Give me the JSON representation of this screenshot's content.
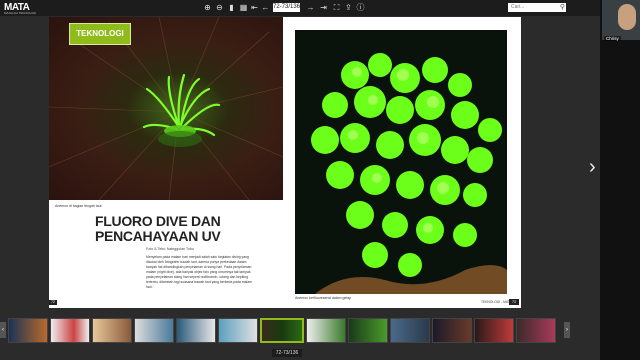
{
  "app": {
    "logo_text": "MATA",
    "logo_subtitle": "MAJALAH TEKNOLOGI"
  },
  "toolbar": {
    "icons": [
      "zoom-in-icon",
      "zoom-out-icon",
      "bookmark-icon",
      "grid-icon",
      "first-page-icon",
      "previous-page-icon",
      "next-page-icon",
      "last-page-icon",
      "fullscreen-icon",
      "share-icon",
      "info-icon"
    ],
    "page_value": "72-73/136",
    "search_placeholder": "Cari..."
  },
  "video": {
    "participant_name": "Chrisy"
  },
  "magazine": {
    "section_tag": "TEKNOLOGI",
    "caption_left": "Anemon di bagian tengah laut",
    "title": "FLUORO DIVE DAN PENCAHAYAAN UV",
    "byline": "Foto & Teks: Nainggolan Tohu",
    "body": "Menyelam pada malam hari menjadi salah satu kegiatan diving yang disukai oleh fotografer bawah laut, karena punya perbedaan dalam banyak hal dibandingkan penyelaman di siang hari. Pada penyelaman malam (night dive), ada banyak objek foto yang umumnya tak tampak pada penyelaman siang hari seperti nudibranch, udang dan kepiting tertentu, ditambah lagi suasana bawah laut yang berbeda pada malam hari.",
    "page_left_number": "72",
    "caption_right": "Anemon berfluoresensi dalam gelap",
    "footer_right": "TEKNOLOGI - MATA 13",
    "page_right_number": "73"
  },
  "navigation": {
    "next_label": "›",
    "strip_prev": "‹",
    "strip_next": "›",
    "bottom_page_label": "72-73/136"
  },
  "colors": {
    "accent": "#8fbc1b",
    "fluoro_green": "#6cff1a"
  }
}
